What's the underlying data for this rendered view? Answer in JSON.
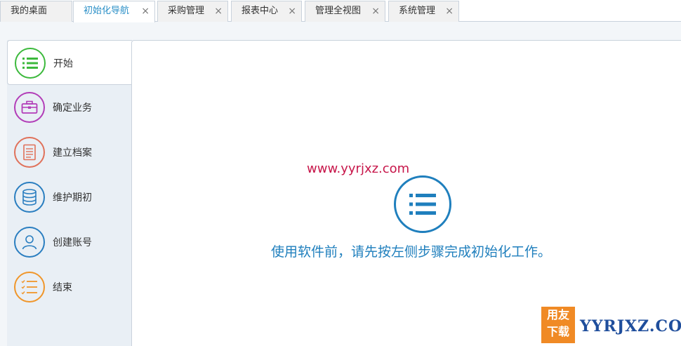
{
  "tabs": [
    {
      "label": "我的桌面",
      "closable": false
    },
    {
      "label": "初始化导航",
      "closable": true,
      "active": true
    },
    {
      "label": "采购管理",
      "closable": true
    },
    {
      "label": "报表中心",
      "closable": true
    },
    {
      "label": "管理全视图",
      "closable": true
    },
    {
      "label": "系统管理",
      "closable": true
    }
  ],
  "close_glyph": "×",
  "nav": {
    "items": [
      {
        "label": "开始",
        "icon": "list-icon",
        "color": "#3cb93c"
      },
      {
        "label": "确定业务",
        "icon": "briefcase-icon",
        "color": "#b23db8"
      },
      {
        "label": "建立档案",
        "icon": "document-icon",
        "color": "#e0715a"
      },
      {
        "label": "维护期初",
        "icon": "database-icon",
        "color": "#2a7ec0"
      },
      {
        "label": "创建账号",
        "icon": "user-icon",
        "color": "#2a7ec0"
      },
      {
        "label": "结束",
        "icon": "checklist-icon",
        "color": "#f0962a"
      }
    ]
  },
  "main": {
    "watermark_url": "www.yyrjxz.com",
    "hint": "使用软件前，请先按左侧步骤完成初始化工作。"
  },
  "logo": {
    "line1": "用友",
    "line2": "下载",
    "text": "YYRJXZ.COM"
  },
  "colors": {
    "accent": "#2a8fc7",
    "hint": "#1f7fbd",
    "watermark": "#c7164a",
    "logo_orange": "#f08a25",
    "logo_blue": "#1f4e9c"
  }
}
